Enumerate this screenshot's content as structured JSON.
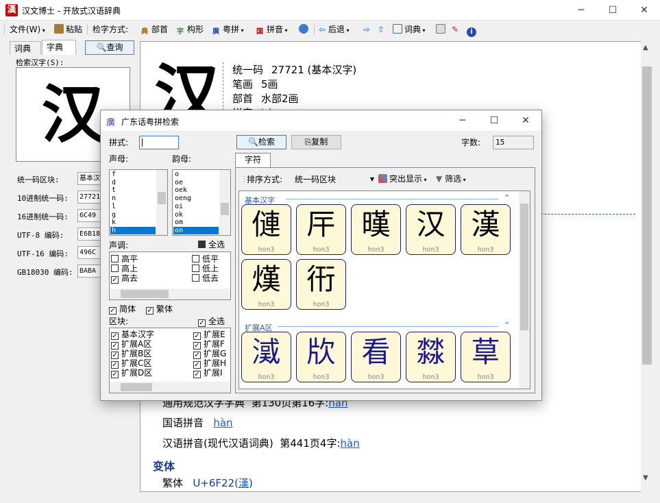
{
  "app": {
    "logo": "漢",
    "title": "汉文博士 - 开放式汉语辞典",
    "min": "─",
    "max": "☐",
    "close": "✕"
  },
  "toolbar": {
    "file": "文件(W)",
    "paste": "粘贴",
    "pick_mode": "检字方式:",
    "radical": "部首",
    "shape": "构形",
    "cantonese": "粤拼",
    "pinyin": "拼音",
    "back": "后退",
    "dict": "词典",
    "radical_icon": "典",
    "shape_icon": "字",
    "canton_icon": "廣",
    "pinyin_icon": "国"
  },
  "left": {
    "tab_ci": "词典",
    "tab_zi": "字典",
    "search": "查询",
    "search_label": "检索汉字(S):",
    "char": "汉",
    "fields": [
      {
        "label": "统一码区块:",
        "value": "基本汉"
      },
      {
        "label": "10进制统一码:",
        "value": "27721"
      },
      {
        "label": "16进制统一码:",
        "value": "6C49"
      },
      {
        "label": "UTF-8 编码:",
        "value": "E6B18"
      },
      {
        "label": "UTF-16 编码:",
        "value": "496C"
      },
      {
        "label": "GB18030 编码:",
        "value": "BABA"
      }
    ]
  },
  "main": {
    "char": "汉",
    "info": [
      {
        "key": "统一码",
        "val": "27721 (基本汉字)"
      },
      {
        "key": "笔画",
        "val": "5画"
      },
      {
        "key": "部首",
        "val": "水部2画"
      },
      {
        "key": "拼音",
        "val": "hàn"
      }
    ],
    "ref1_label": "通用规范汉字字典",
    "ref1_page": "第130页第16字:",
    "ref1_link": "hàn",
    "guoyu_label": "国语拼音",
    "guoyu_link": "hàn",
    "modern_label": "汉语拼音(现代汉语词典)",
    "modern_page": "第441页4字:",
    "modern_link": "hàn",
    "variant_title": "变体",
    "trad_label": "繁体",
    "trad_code": "U+6F22(",
    "trad_char": "漢",
    "trad_close": ")"
  },
  "dialog": {
    "icon": "廣",
    "title": "广东话粤拼检索",
    "pinyin_label": "拼式:",
    "search_btn": "检索",
    "copy_btn": "复制",
    "count_label": "字数:",
    "count": "15",
    "initial_label": "声母:",
    "final_label": "韵母:",
    "initials": [
      "f",
      "d",
      "t",
      "n",
      "l",
      "g",
      "k",
      "h"
    ],
    "finals": [
      "o",
      "oe",
      "oek",
      "oeng",
      "oi",
      "ok",
      "om",
      "on"
    ],
    "tone_label": "声调:",
    "select_all": "全选",
    "tones_left": [
      {
        "t": "高平",
        "c": false
      },
      {
        "t": "高上",
        "c": false
      },
      {
        "t": "高去",
        "c": true
      }
    ],
    "tones_right": [
      {
        "t": "低平",
        "c": false
      },
      {
        "t": "低上",
        "c": false
      },
      {
        "t": "低去",
        "c": false
      }
    ],
    "simp": "简体",
    "trad": "繁体",
    "block_label": "区块:",
    "block_select_all": "全选",
    "blocks_left": [
      "基本汉字",
      "扩展A区",
      "扩展B区",
      "扩展C区",
      "扩展D区"
    ],
    "blocks_right": [
      "扩展E",
      "扩展F",
      "扩展G",
      "扩展H",
      "扩展I"
    ],
    "result_tab": "字符",
    "sort_label": "排序方式:",
    "sort_value": "统一码区块",
    "highlight": "突出显示",
    "filter": "筛选",
    "group1": "基本汉字",
    "group2": "扩展A区",
    "cards1": [
      {
        "c": "僆",
        "p": "hon3"
      },
      {
        "c": "厈",
        "p": "hon3"
      },
      {
        "c": "暵",
        "p": "hon3"
      },
      {
        "c": "汉",
        "p": "hon3"
      },
      {
        "c": "漢",
        "p": "hon3"
      },
      {
        "c": "熯",
        "p": "hon3"
      },
      {
        "c": "衎",
        "p": "hon3"
      }
    ],
    "cards2": [
      {
        "c": "㵄",
        "p": "hon3"
      },
      {
        "c": "㸝",
        "p": "hon3"
      },
      {
        "c": "看",
        "p": "hon3"
      },
      {
        "c": "㵘",
        "p": "hon3"
      },
      {
        "c": "䓍",
        "p": "hon3"
      }
    ]
  }
}
